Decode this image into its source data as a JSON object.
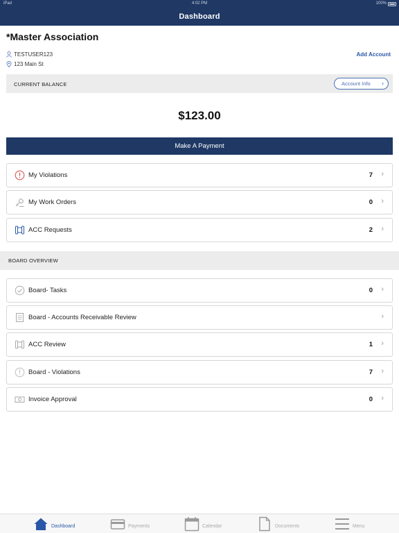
{
  "status_bar": {
    "device": "iPad",
    "time": "4:02 PM",
    "battery": "100%"
  },
  "header": {
    "title": "Dashboard"
  },
  "association": {
    "name": "*Master Association",
    "user": "TESTUSER123",
    "address": "123 Main St",
    "add_account_label": "Add Account"
  },
  "balance": {
    "label": "CURRENT BALANCE",
    "account_info_label": "Account Info",
    "amount": "$123.00",
    "pay_label": "Make A Payment"
  },
  "my_items": [
    {
      "label": "My Violations",
      "count": "7",
      "icon": "alert-circle-icon"
    },
    {
      "label": "My Work Orders",
      "count": "0",
      "icon": "wrench-icon"
    },
    {
      "label": "ACC Requests",
      "count": "2",
      "icon": "blueprint-icon"
    }
  ],
  "board": {
    "header": "BOARD OVERVIEW",
    "items": [
      {
        "label": "Board- Tasks",
        "count": "0",
        "icon": "check-circle-icon"
      },
      {
        "label": "Board - Accounts Receivable Review",
        "count": "",
        "icon": "ledger-icon"
      },
      {
        "label": "ACC Review",
        "count": "1",
        "icon": "blueprint-icon"
      },
      {
        "label": "Board - Violations",
        "count": "7",
        "icon": "alert-circle-icon"
      },
      {
        "label": "Invoice Approval",
        "count": "0",
        "icon": "money-icon"
      }
    ]
  },
  "tabs": [
    {
      "label": "Dashboard",
      "icon": "home-icon",
      "active": true
    },
    {
      "label": "Payments",
      "icon": "credit-card-icon",
      "active": false
    },
    {
      "label": "Calendar",
      "icon": "calendar-icon",
      "active": false
    },
    {
      "label": "Documents",
      "icon": "document-icon",
      "active": false
    },
    {
      "label": "Menu",
      "icon": "menu-icon",
      "active": false
    }
  ],
  "colors": {
    "header": "#1f3864",
    "accent": "#2a58a8",
    "alert": "#d9534f",
    "section_bg": "#ececec"
  }
}
